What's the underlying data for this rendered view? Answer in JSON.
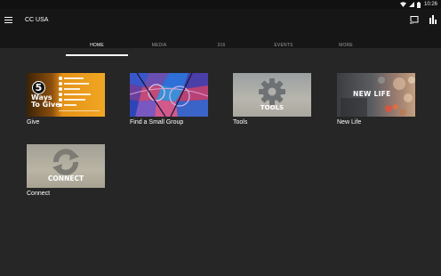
{
  "status_bar": {
    "time": "10:26",
    "icons": [
      "wifi-icon",
      "signal-icon",
      "battery-icon"
    ]
  },
  "app_bar": {
    "title": "CC USA",
    "icons": [
      "menu-icon",
      "cast-icon",
      "stats-icon"
    ]
  },
  "tabs": [
    {
      "label": "HOME",
      "active": true
    },
    {
      "label": "MEDIA",
      "active": false
    },
    {
      "label": "316",
      "active": false
    },
    {
      "label": "EVENTS",
      "active": false
    },
    {
      "label": "MORE",
      "active": false
    }
  ],
  "tiles": [
    {
      "label": "Give",
      "thumb": {
        "number": "5",
        "words": [
          "Ways",
          "To Give"
        ],
        "icon": "five-ways-badge-icon"
      }
    },
    {
      "label": "Find a Small Group",
      "thumb": {
        "icon": "stained-glass-icon"
      }
    },
    {
      "label": "Tools",
      "thumb": {
        "text": "TOOLS",
        "icon": "gear-icon"
      }
    },
    {
      "label": "New Life",
      "thumb": {
        "text": "NEW LIFE",
        "icon": "bokeh-photo-icon"
      }
    },
    {
      "label": "Connect",
      "thumb": {
        "text": "CONNECT",
        "icon": "refresh-arrows-icon"
      }
    }
  ],
  "colors": {
    "background": "#262626",
    "app_bar": "#161616",
    "status_bar": "#111111",
    "tab_inactive": "#9a9a9a",
    "tab_active": "#ffffff",
    "give_orange": "#e8961a"
  }
}
